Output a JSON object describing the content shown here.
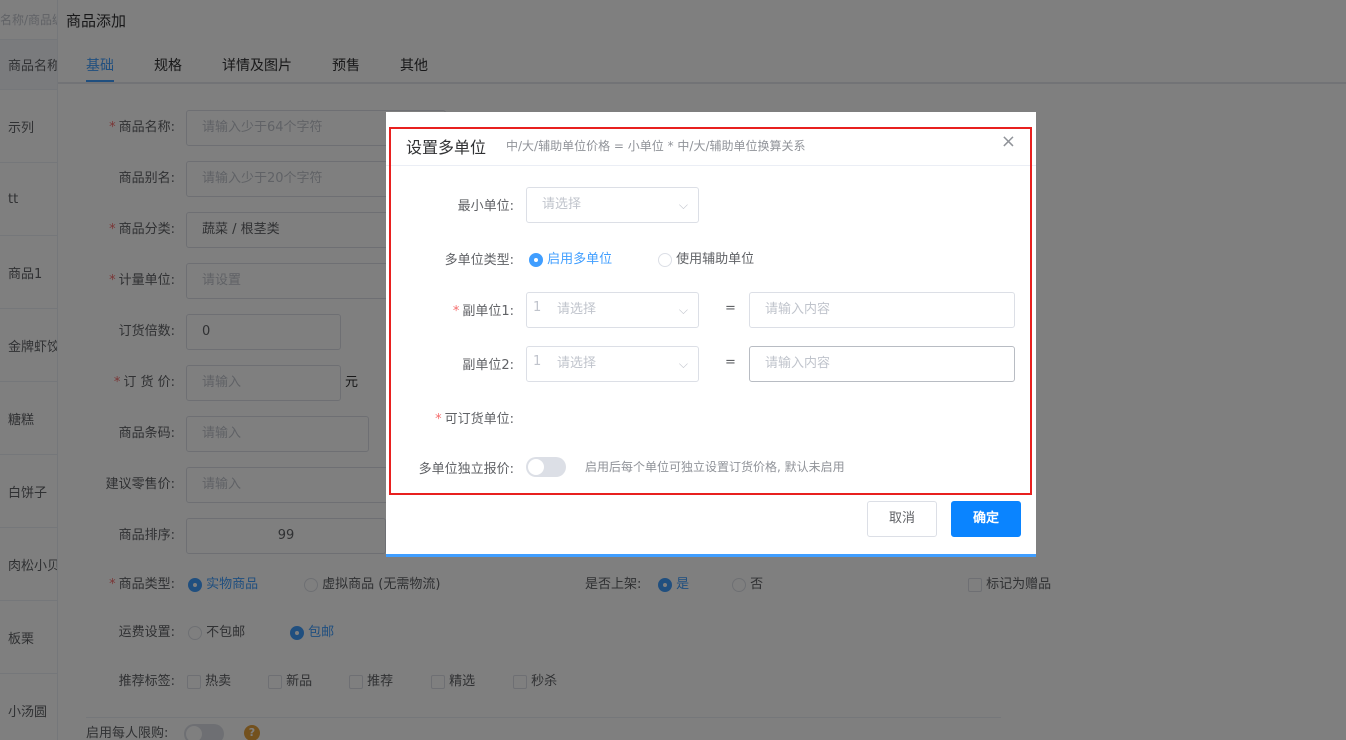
{
  "list": {
    "search_placeholder": "名称/商品编号",
    "items": [
      "商品名称",
      "示列",
      "tt",
      "商品1",
      "金牌虾饺",
      "糖糕",
      "白饼子",
      "肉松小贝",
      "板栗",
      "小汤圆"
    ]
  },
  "drawer": {
    "title": "商品添加",
    "tabs": [
      "基础",
      "规格",
      "详情及图片",
      "预售",
      "其他"
    ],
    "fields": {
      "name_label": "商品名称:",
      "name_placeholder": "请输入少于64个字符",
      "alias_label": "商品别名:",
      "alias_placeholder": "请输入少于20个字符",
      "category_label": "商品分类:",
      "category_value": "蔬菜 / 根茎类",
      "unit_label": "计量单位:",
      "unit_placeholder": "请设置",
      "multiple_label": "订货倍数:",
      "multiple_value": "0",
      "price_label": "订 货 价:",
      "price_placeholder": "请输入",
      "price_unit": "元",
      "barcode_label": "商品条码:",
      "barcode_placeholder": "请输入",
      "retail_label": "建议零售价:",
      "retail_placeholder": "请输入",
      "sort_label": "商品排序:",
      "sort_value": "99",
      "type_label": "商品类型:",
      "type_physical": "实物商品",
      "type_virtual": "虚拟商品 (无需物流)",
      "shelf_label": "是否上架:",
      "shelf_yes": "是",
      "shelf_no": "否",
      "gift_label": "标记为赠品",
      "shipping_label": "运费设置:",
      "shipping_no": "不包邮",
      "shipping_yes": "包邮",
      "tags_label": "推荐标签:",
      "tags": [
        "热卖",
        "新品",
        "推荐",
        "精选",
        "秒杀"
      ],
      "limit_label": "启用每人限购:",
      "help_icon": "?"
    }
  },
  "dialog": {
    "title": "设置多单位",
    "subtitle": "中/大/辅助单位价格 = 小单位 * 中/大/辅助单位换算关系",
    "close_icon": "×",
    "min_unit_label": "最小单位:",
    "min_unit_placeholder": "请选择",
    "multi_type_label": "多单位类型:",
    "option_multi": "启用多单位",
    "option_aux": "使用辅助单位",
    "sub_unit1_label": "副单位1:",
    "sub_unit2_label": "副单位2:",
    "qty": "1",
    "select_placeholder": "请选择",
    "equals": "=",
    "content_placeholder": "请输入内容",
    "orderable_label": "可订货单位:",
    "independent_label": "多单位独立报价:",
    "independent_hint": "启用后每个单位可独立设置订货价格, 默认未启用",
    "cancel_label": "取消",
    "ok_label": "确定"
  },
  "colors": {
    "accent": "#409eff",
    "primary_button": "#0a84ff",
    "highlight_border": "#e8201f",
    "required": "#f56c6c"
  }
}
